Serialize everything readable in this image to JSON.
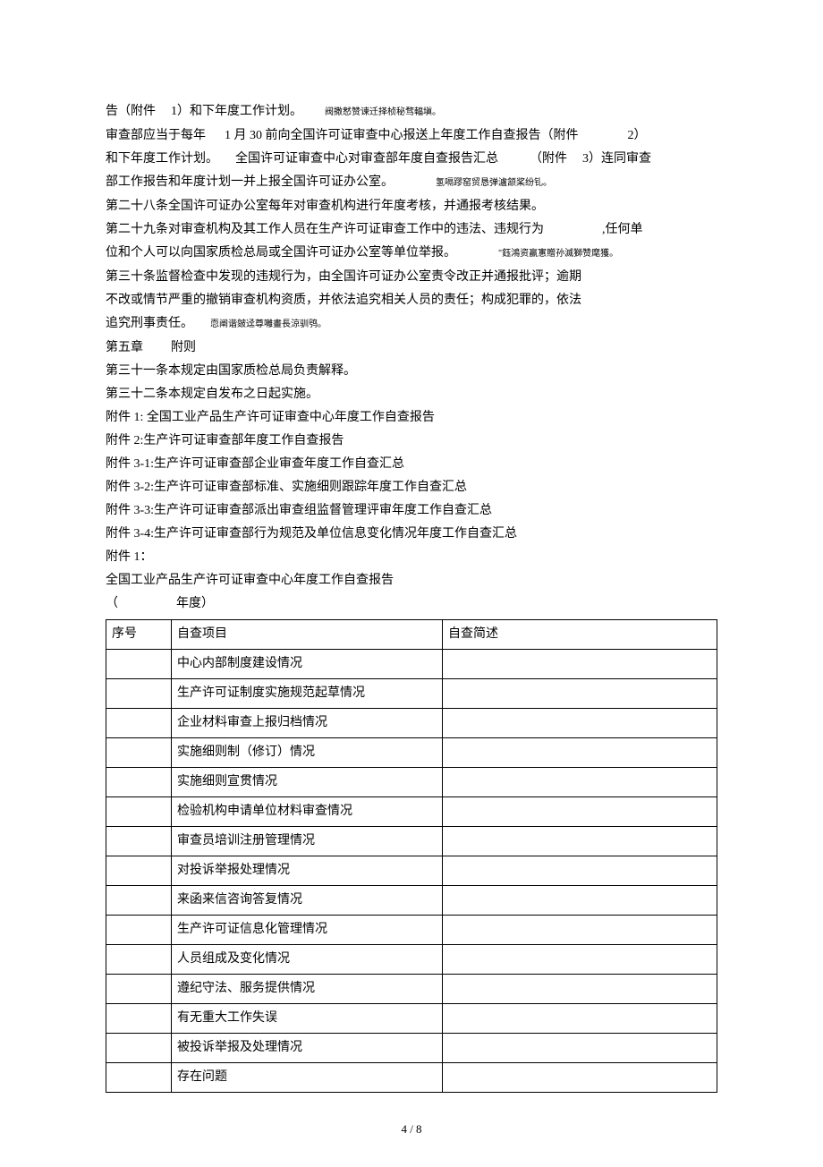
{
  "paragraphs": {
    "p1_a": "告（附件",
    "p1_b": "1）和下年度工作计划。",
    "p1_note": "阀撒慭赞谏迁择桢秘骛輻塡。",
    "p2_a": "审查部应当于每年",
    "p2_b": "1 月 30 前向全国许可证审查中心报送上年度工作自查报告（附件",
    "p2_c": "2）",
    "p3_a": "和下年度工作计划。",
    "p3_b": "全国许可证审查中心对审查部年度自查报告汇总",
    "p3_c": "（附件",
    "p3_d": "3）连同审查",
    "p4_a": "部工作报告和年度计划一并上报全国许可证办公室。",
    "p4_note": "氢嗝蹘窑贸恳弹瀘颔桨纷钆。",
    "p5": "第二十八条全国许可证办公室每年对审查机构进行年度考核，并通报考核结果。",
    "p6_a": "第二十九条对审查机构及其工作人员在生产许可证审查工作中的违法、违规行为",
    "p6_b": ",任何单",
    "p7_a": "位和个人可以向国家质检总局或全国许可证办公室等单位举报。",
    "p7_note": "\"鈺鴻资赢寭贈孙滅獅赞麾獲。",
    "p8": "第三十条监督检查中发现的违规行为，由全国许可证办公室责令改正并通报批评；逾期",
    "p9": "不改或情节严重的撤销审查机构资质，并依法追究相关人员的责任；构成犯罪的，依法",
    "p10_a": "追究刑事责任。",
    "p10_note": "恧阐谐皴迳尊囄畫長涼驯鸮。",
    "p11_a": "第五章",
    "p11_b": "附则",
    "p12": "第三十一条本规定由国家质检总局负责解释。",
    "p13": "第三十二条本规定自发布之日起实施。",
    "p14": "附件 1: 全国工业产品生产许可证审查中心年度工作自查报告",
    "p15": "附件 2:生产许可证审查部年度工作自查报告",
    "p16": "附件 3-1:生产许可证审查部企业审查年度工作自查汇总",
    "p17": "附件 3-2:生产许可证审查部标准、实施细则跟踪年度工作自查汇总",
    "p18": "附件 3-3:生产许可证审查部派出审查组监督管理评审年度工作自查汇总",
    "p19": "附件 3-4:生产许可证审查部行为规范及单位信息变化情况年度工作自查汇总",
    "p20": "附件 1：",
    "p21": "全国工业产品生产许可证审查中心年度工作自查报告",
    "p22_a": "（",
    "p22_b": "年度）"
  },
  "table": {
    "header": {
      "seq": "序号",
      "item": "自查项目",
      "desc": "自查简述"
    },
    "rows": [
      {
        "seq": "",
        "item": "中心内部制度建设情况",
        "desc": ""
      },
      {
        "seq": "",
        "item": "生产许可证制度实施规范起草情况",
        "desc": ""
      },
      {
        "seq": "",
        "item": "企业材料审查上报归档情况",
        "desc": ""
      },
      {
        "seq": "",
        "item": "实施细则制（修订）情况",
        "desc": ""
      },
      {
        "seq": "",
        "item": "实施细则宣贯情况",
        "desc": ""
      },
      {
        "seq": "",
        "item": "检验机构申请单位材料审查情况",
        "desc": ""
      },
      {
        "seq": "",
        "item": "审查员培训注册管理情况",
        "desc": ""
      },
      {
        "seq": "",
        "item": "对投诉举报处理情况",
        "desc": ""
      },
      {
        "seq": "",
        "item": "来函来信咨询答复情况",
        "desc": ""
      },
      {
        "seq": "",
        "item": "生产许可证信息化管理情况",
        "desc": ""
      },
      {
        "seq": "",
        "item": "人员组成及变化情况",
        "desc": ""
      },
      {
        "seq": "",
        "item": "遵纪守法、服务提供情况",
        "desc": ""
      },
      {
        "seq": "",
        "item": "有无重大工作失误",
        "desc": ""
      },
      {
        "seq": "",
        "item": "被投诉举报及处理情况",
        "desc": ""
      },
      {
        "seq": "",
        "item": "存在问题",
        "desc": ""
      }
    ]
  },
  "footer": "4 / 8"
}
